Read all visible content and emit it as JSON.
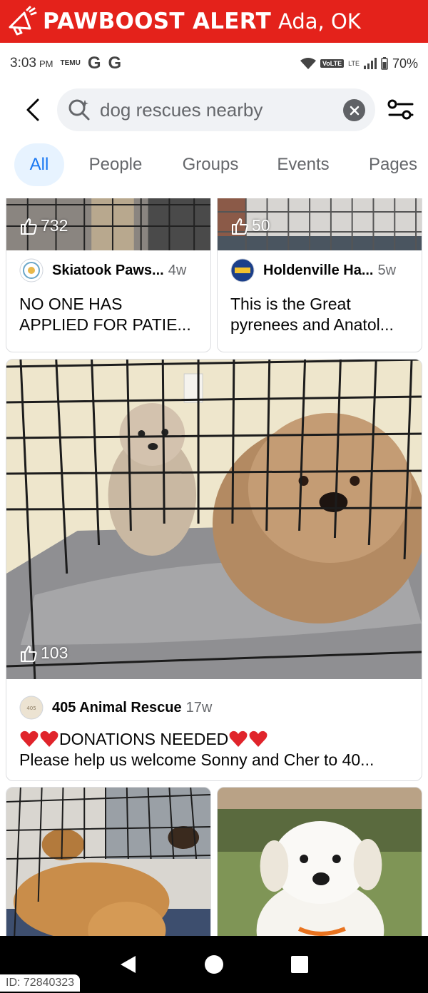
{
  "alert": {
    "title": "PAWBOOST ALERT",
    "location": "Ada, OK"
  },
  "status_bar": {
    "time": "3:03",
    "ampm": "PM",
    "temu_label": "TEMU",
    "g_icons": [
      "G",
      "G"
    ],
    "volte": "VoLTE",
    "lte": "LTE",
    "battery": "70%"
  },
  "search": {
    "value": "dog rescues nearby"
  },
  "tabs": [
    {
      "label": "All",
      "active": true
    },
    {
      "label": "People",
      "active": false
    },
    {
      "label": "Groups",
      "active": false
    },
    {
      "label": "Events",
      "active": false
    },
    {
      "label": "Pages",
      "active": false
    }
  ],
  "posts": [
    {
      "likes": "732",
      "page": "Skiatook Paws...",
      "age": "4w",
      "text_lines": [
        "NO ONE HAS",
        "APPLIED FOR PATIE..."
      ]
    },
    {
      "likes": "50",
      "page": "Holdenville Ha...",
      "age": "5w",
      "text_lines": [
        "This is the Great",
        "pyrenees and Anatol..."
      ]
    },
    {
      "likes": "103",
      "page": "405 Animal Rescue",
      "age": "17w",
      "text_line1": "DONATIONS NEEDED",
      "text_line2": "Please help us welcome Sonny and Cher to 40..."
    }
  ],
  "listing_id": "ID: 72840323",
  "colors": {
    "alert_red": "#e4221b",
    "fb_blue": "#1877f2",
    "tab_active_bg": "#e7f3ff",
    "heart_red": "#e0242b"
  }
}
